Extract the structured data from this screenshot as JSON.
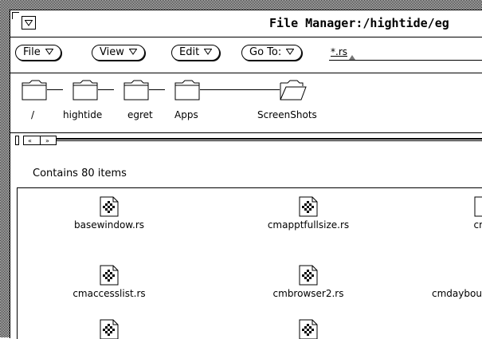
{
  "window": {
    "title": "File Manager:/hightide/eg",
    "menu_button_icon": "triangle-down-icon"
  },
  "controls": {
    "file": "File",
    "view": "View",
    "edit": "Edit",
    "goto": "Go To:",
    "filter_value": "*.rs"
  },
  "path": {
    "folders": [
      {
        "label": "/",
        "icon": "folder-icon"
      },
      {
        "label": "hightide",
        "icon": "folder-icon"
      },
      {
        "label": "egret",
        "icon": "folder-icon"
      },
      {
        "label": "Apps",
        "icon": "folder-icon"
      },
      {
        "label": "ScreenShots",
        "icon": "open-folder-icon"
      }
    ]
  },
  "status": {
    "text": "Contains 80 items"
  },
  "files": [
    {
      "name": "basewindow.rs",
      "icon": "raster-file-icon"
    },
    {
      "name": "cmapptfullsize.rs",
      "icon": "raster-file-icon"
    },
    {
      "name": "cmc",
      "icon": "raster-file-icon"
    },
    {
      "name": "cmaccesslist.rs",
      "icon": "raster-file-icon"
    },
    {
      "name": "cmbrowser2.rs",
      "icon": "raster-file-icon"
    },
    {
      "name": "cmdaybou",
      "icon": "raster-file-icon"
    },
    {
      "name": "",
      "icon": "raster-file-icon"
    },
    {
      "name": "",
      "icon": "raster-file-icon"
    }
  ]
}
